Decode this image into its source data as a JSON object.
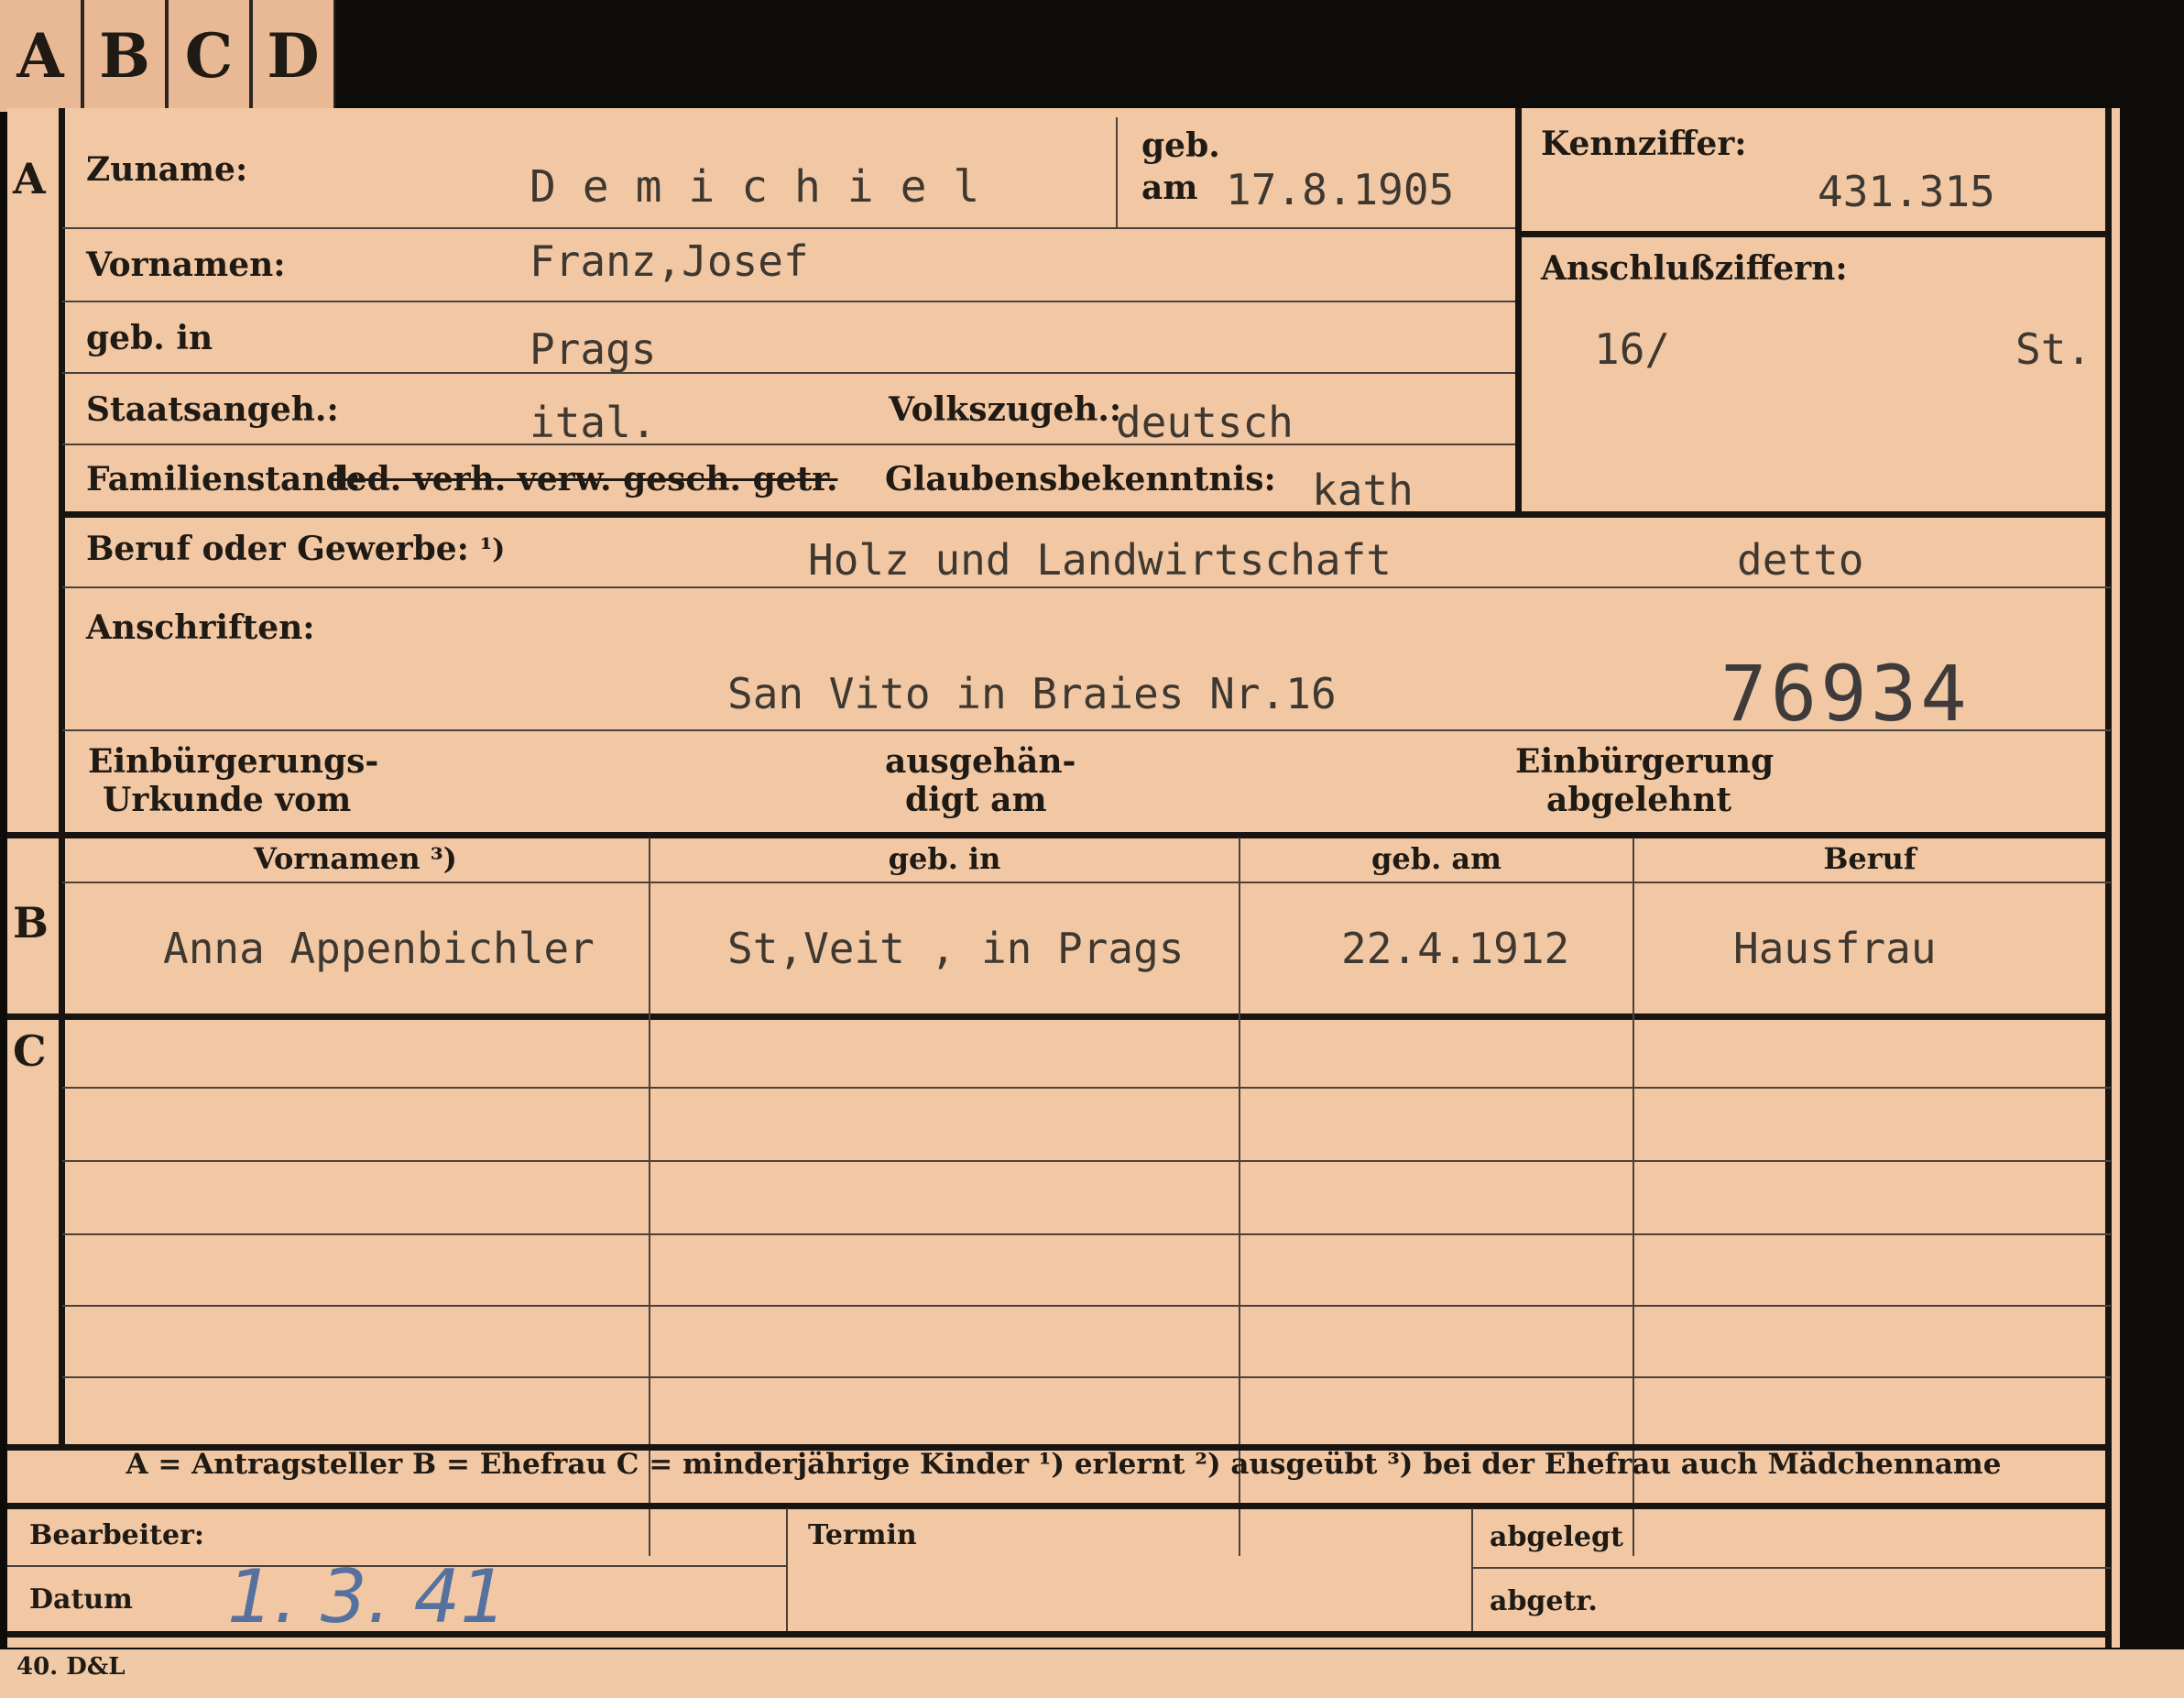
{
  "tabs": [
    "A",
    "B",
    "C",
    "D"
  ],
  "sections": {
    "a": "A",
    "b": "B",
    "c": "C"
  },
  "fields": {
    "zuname_label": "Zuname:",
    "zuname_value": "D e m i c h i e l",
    "geb_label": "geb.",
    "am_label": "am",
    "geb_am_value": "17.8.1905",
    "kennziffer_label": "Kennziffer:",
    "kennziffer_value": "431.315",
    "vornamen_label": "Vornamen:",
    "vornamen_value": "Franz,Josef",
    "anschluss_label": "Anschlußziffern:",
    "anschluss_value": "16/",
    "anschluss_suffix": "St.",
    "geb_in_label": "geb. in",
    "geb_in_value": "Prags",
    "staats_label": "Staatsangeh.:",
    "staats_value": "ital.",
    "volks_label": "Volkszugeh.:",
    "volks_value": "deutsch",
    "familien_label": "Familienstand:",
    "familien_options": " led. verh. verw. gesch. getr.",
    "glaubens_label": "Glaubensbekenntnis:",
    "glaubens_value": "kath",
    "beruf_label": "Beruf oder Gewerbe:",
    "beruf_note": "¹)",
    "beruf_value": "Holz und Landwirtschaft",
    "beruf_value2": "detto",
    "anschriften_label": "Anschriften:",
    "anschriften_value": "San Vito in Braies  Nr.16",
    "stamp_number": "76934",
    "einb_label1": "Einbürgerungs-",
    "einb_label2": "Urkunde vom",
    "ausgeh_label1": "ausgehän-",
    "ausgeh_label2": "digt am",
    "abgelehnt_label1": "Einbürgerung",
    "abgelehnt_label2": "abgelehnt"
  },
  "spouse": {
    "headers": [
      "Vornamen ³)",
      "geb. in",
      "geb. am",
      "Beruf"
    ],
    "row": [
      "Anna Appenbichler",
      "St,Veit , in Prags",
      "22.4.1912",
      "Hausfrau"
    ]
  },
  "legend": "A = Antragsteller   B = Ehefrau   C = minderjährige Kinder   ¹) erlernt   ²) ausgeübt   ³) bei der Ehefrau auch Mädchenname",
  "footer": {
    "bearbeiter_label": "Bearbeiter:",
    "datum_label": "Datum",
    "datum_value": "1. 3. 41",
    "termin_label": "Termin",
    "abgelegt_label": "abgelegt",
    "abgetr_label": "abgetr.",
    "print_code": "40. D&L"
  }
}
